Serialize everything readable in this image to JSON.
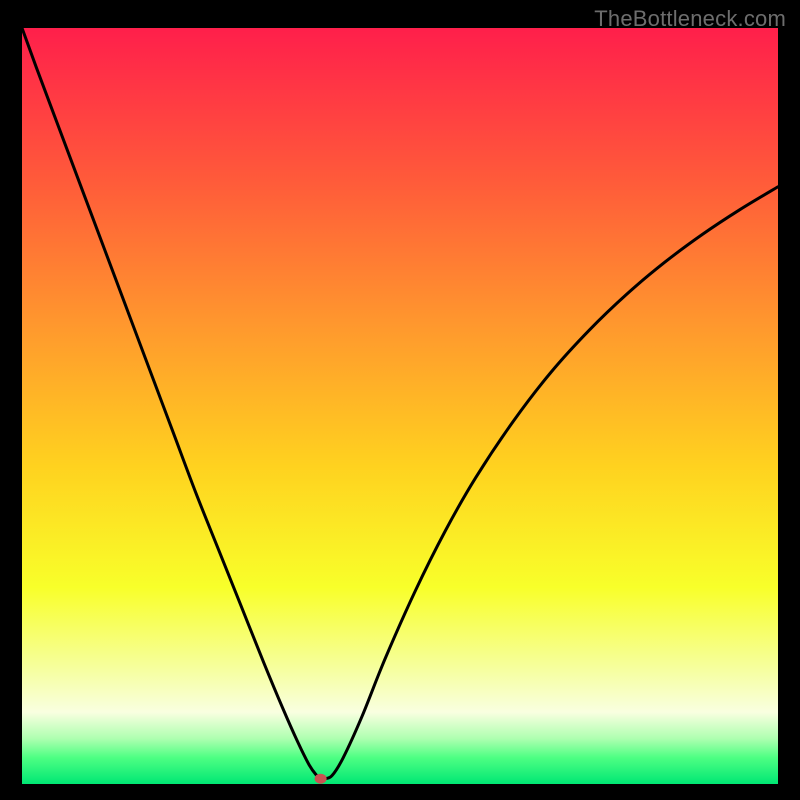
{
  "watermark": "TheBottleneck.com",
  "chart_data": {
    "type": "line",
    "title": "",
    "xlabel": "",
    "ylabel": "",
    "xlim": [
      0,
      100
    ],
    "ylim": [
      0,
      100
    ],
    "grid": false,
    "legend": false,
    "gradient_stops": [
      {
        "offset": 0.0,
        "color": "#ff1f4b"
      },
      {
        "offset": 0.2,
        "color": "#ff5a3a"
      },
      {
        "offset": 0.4,
        "color": "#ff9a2d"
      },
      {
        "offset": 0.58,
        "color": "#ffd21f"
      },
      {
        "offset": 0.74,
        "color": "#f8ff2a"
      },
      {
        "offset": 0.85,
        "color": "#f6ffa1"
      },
      {
        "offset": 0.905,
        "color": "#f9ffe0"
      },
      {
        "offset": 0.94,
        "color": "#aeffb0"
      },
      {
        "offset": 0.965,
        "color": "#4eff83"
      },
      {
        "offset": 1.0,
        "color": "#00e774"
      }
    ],
    "marker": {
      "x": 39.5,
      "y": 0.7,
      "color": "#c95252"
    },
    "series": [
      {
        "name": "curve",
        "x": [
          0.0,
          2,
          5,
          8,
          11,
          14,
          17,
          20,
          23,
          26,
          29,
          32,
          34.5,
          36.5,
          38,
          39,
          39.5,
          40,
          41,
          42.5,
          45,
          48,
          52,
          56,
          60,
          65,
          70,
          75,
          80,
          85,
          90,
          95,
          100
        ],
        "y": [
          100,
          94.5,
          86.5,
          78.5,
          70.5,
          62.5,
          54.5,
          46.5,
          38.5,
          31,
          23.5,
          16,
          10,
          5.5,
          2.5,
          1.1,
          0.7,
          0.7,
          1.1,
          3.5,
          9,
          16.5,
          25.5,
          33.5,
          40.5,
          48,
          54.5,
          60,
          64.8,
          69,
          72.7,
          76,
          79
        ]
      }
    ]
  }
}
